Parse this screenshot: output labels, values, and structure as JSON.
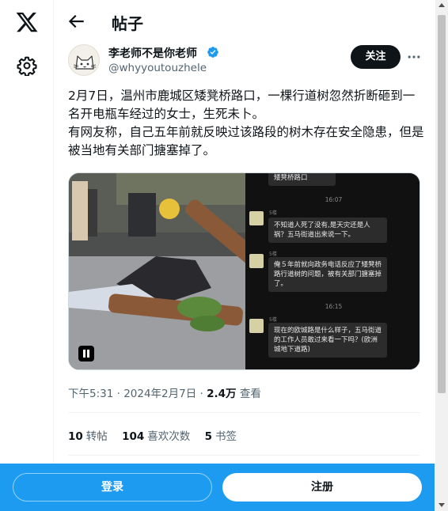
{
  "header": {
    "title": "帖子"
  },
  "author": {
    "name": "李老师不是你老师",
    "handle": "@whyyoutouzhele",
    "follow_label": "关注"
  },
  "tweet": {
    "paragraph1": "2月7日，温州市鹿城区矮凳桥路口，一棵行道树忽然折断砸到一名开电瓶车经过的女士，生死未卜。",
    "paragraph2": "有网友称，自己五年前就反映过该路段的树木存在安全隐患，但是被当地有关部门搪塞掉了。"
  },
  "media": {
    "chat": {
      "top_snippet": "矮凳桥路口",
      "time1": "16:07",
      "msg1_name": "5楼",
      "msg1": "不知道人死了没有,是天灾还是人祸？五马街道出来说一下。",
      "msg2_name": "5楼",
      "msg2": "俺５年前就向政务电话反应了矮凳桥路行道树的问题，被有关部门搪塞掉了。",
      "time2": "16:15",
      "msg3_name": "5楼",
      "msg3": "现在的欧城路是什么样子，五马街道的工作人员敢过来看一下吗？(欧洲城地下道路)"
    }
  },
  "meta": {
    "time_date": "下午5:31 · 2024年2月7日 · ",
    "views_count": "2.4万",
    "views_label": " 查看"
  },
  "stats": {
    "retweets_count": "10",
    "retweets_label": "转帖",
    "likes_count": "104",
    "likes_label": "喜欢次数",
    "bookmarks_count": "5",
    "bookmarks_label": "书签"
  },
  "bottom": {
    "login_label": "登录",
    "signup_label": "注册"
  },
  "icons": {
    "logo": "x-logo-icon",
    "settings": "gear-icon",
    "back": "arrow-left-icon",
    "verified": "verified-badge-icon",
    "more": "more-horizontal-icon",
    "pause": "pause-icon"
  },
  "colors": {
    "accent": "#1d9bf0",
    "text": "#0f1419",
    "muted": "#536471"
  }
}
